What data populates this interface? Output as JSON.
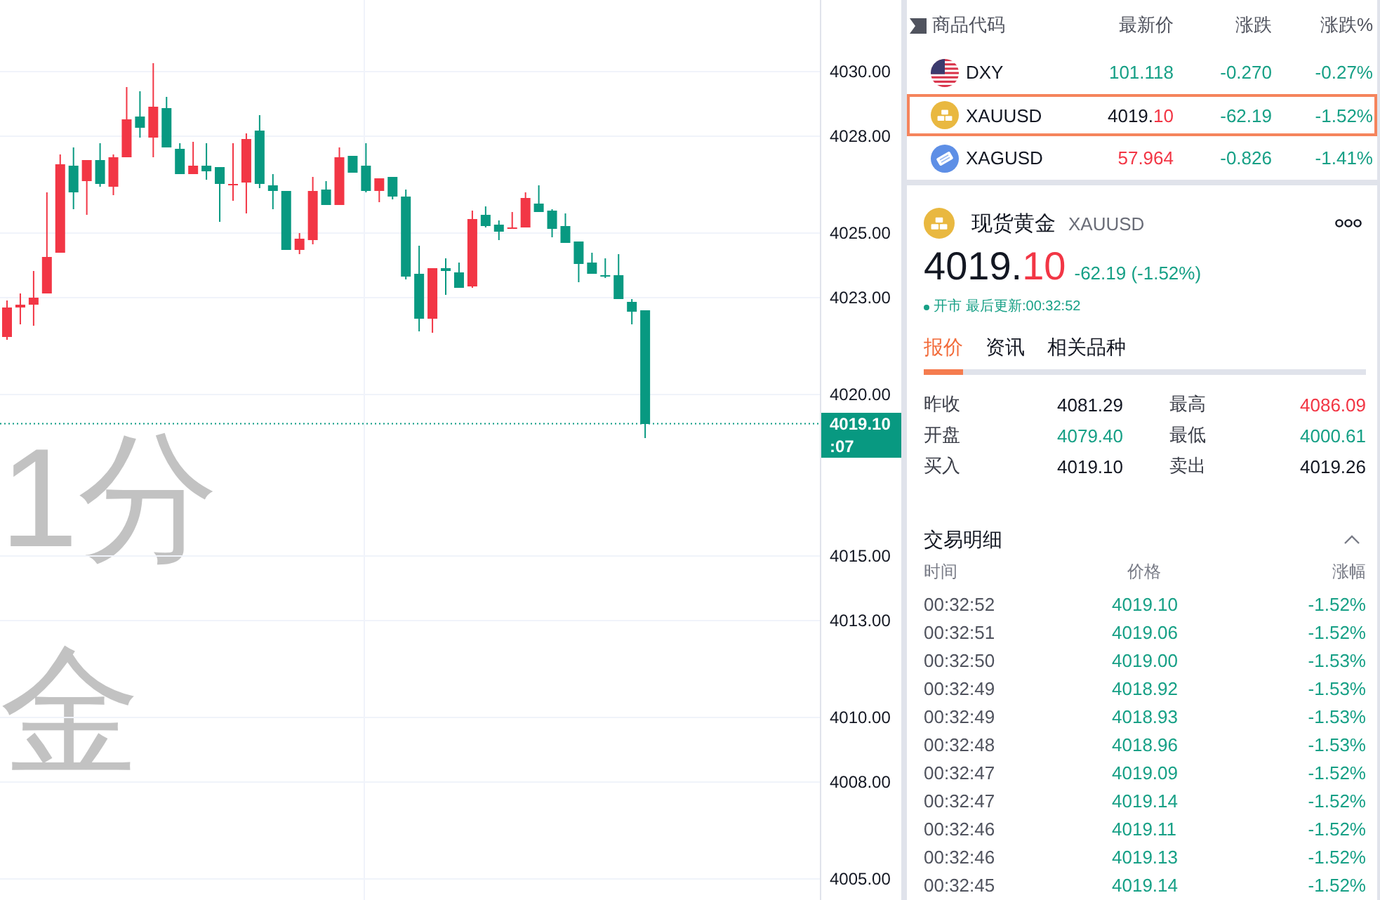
{
  "chart": {
    "watermark_lines": [
      "1分",
      "金"
    ],
    "y_ticks": [
      "4030.00",
      "4028.00",
      "4025.00",
      "4023.00",
      "4020.00",
      "4015.00",
      "4013.00",
      "4010.00",
      "4008.00",
      "4005.00"
    ],
    "price_tag": {
      "price": "4019.10",
      "countdown": ":07"
    }
  },
  "watchlist": {
    "columns": [
      "商品代码",
      "最新价",
      "涨跌",
      "涨跌%"
    ],
    "rows": [
      {
        "kind": "flag",
        "symbol": "DXY",
        "price": [
          {
            "text": "101.118",
            "color": "#17a086"
          }
        ],
        "change": {
          "text": "-0.270",
          "color": "#17a086"
        },
        "change_pct": {
          "text": "-0.27%",
          "color": "#17a086"
        },
        "selected": false
      },
      {
        "kind": "gold",
        "symbol": "XAUUSD",
        "price": [
          {
            "text": "4019.",
            "color": "#131722"
          },
          {
            "text": "10",
            "color": "#f23645"
          }
        ],
        "change": {
          "text": "-62.19",
          "color": "#17a086"
        },
        "change_pct": {
          "text": "-1.52%",
          "color": "#17a086"
        },
        "selected": true
      },
      {
        "kind": "silver",
        "symbol": "XAGUSD",
        "price": [
          {
            "text": "57.964",
            "color": "#f23645"
          }
        ],
        "change": {
          "text": "-0.826",
          "color": "#17a086"
        },
        "change_pct": {
          "text": "-1.41%",
          "color": "#17a086"
        },
        "selected": false
      }
    ]
  },
  "quote": {
    "kind": "gold",
    "name": "现货黄金",
    "symbol": "XAUUSD",
    "price": [
      {
        "text": "4019.",
        "color": "#131722"
      },
      {
        "text": "10",
        "color": "#f23645"
      }
    ],
    "change": {
      "text": "-62.19 (-1.52%)",
      "color": "#17a086"
    },
    "status": {
      "open": true,
      "label": "开市",
      "updated": "最后更新:00:32:52"
    },
    "tabs": [
      {
        "label": "报价",
        "selected": true
      },
      {
        "label": "资讯",
        "selected": false
      },
      {
        "label": "相关品种",
        "selected": false
      }
    ],
    "stats": [
      {
        "label": "昨收",
        "value": "4081.29",
        "color": "#131722"
      },
      {
        "label": "最高",
        "value": "4086.09",
        "color": "#f23645"
      },
      {
        "label": "开盘",
        "value": "4079.40",
        "color": "#17a086"
      },
      {
        "label": "最低",
        "value": "4000.61",
        "color": "#17a086"
      },
      {
        "label": "买入",
        "value": "4019.10",
        "color": "#131722"
      },
      {
        "label": "卖出",
        "value": "4019.26",
        "color": "#131722"
      }
    ]
  },
  "trades": {
    "title": "交易明细",
    "expanded": true,
    "columns": [
      "时间",
      "价格",
      "涨幅"
    ],
    "rows": [
      {
        "time": "00:32:52",
        "price": "4019.10",
        "change": "-1.52%",
        "color": "#17a086"
      },
      {
        "time": "00:32:51",
        "price": "4019.06",
        "change": "-1.52%",
        "color": "#17a086"
      },
      {
        "time": "00:32:50",
        "price": "4019.00",
        "change": "-1.53%",
        "color": "#17a086"
      },
      {
        "time": "00:32:49",
        "price": "4018.92",
        "change": "-1.53%",
        "color": "#17a086"
      },
      {
        "time": "00:32:49",
        "price": "4018.93",
        "change": "-1.53%",
        "color": "#17a086"
      },
      {
        "time": "00:32:48",
        "price": "4018.96",
        "change": "-1.53%",
        "color": "#17a086"
      },
      {
        "time": "00:32:47",
        "price": "4019.09",
        "change": "-1.52%",
        "color": "#17a086"
      },
      {
        "time": "00:32:47",
        "price": "4019.14",
        "change": "-1.52%",
        "color": "#17a086"
      },
      {
        "time": "00:32:46",
        "price": "4019.11",
        "change": "-1.52%",
        "color": "#17a086"
      },
      {
        "time": "00:32:46",
        "price": "4019.13",
        "change": "-1.52%",
        "color": "#17a086"
      },
      {
        "time": "00:32:45",
        "price": "4019.14",
        "change": "-1.52%",
        "color": "#17a086"
      }
    ]
  }
}
